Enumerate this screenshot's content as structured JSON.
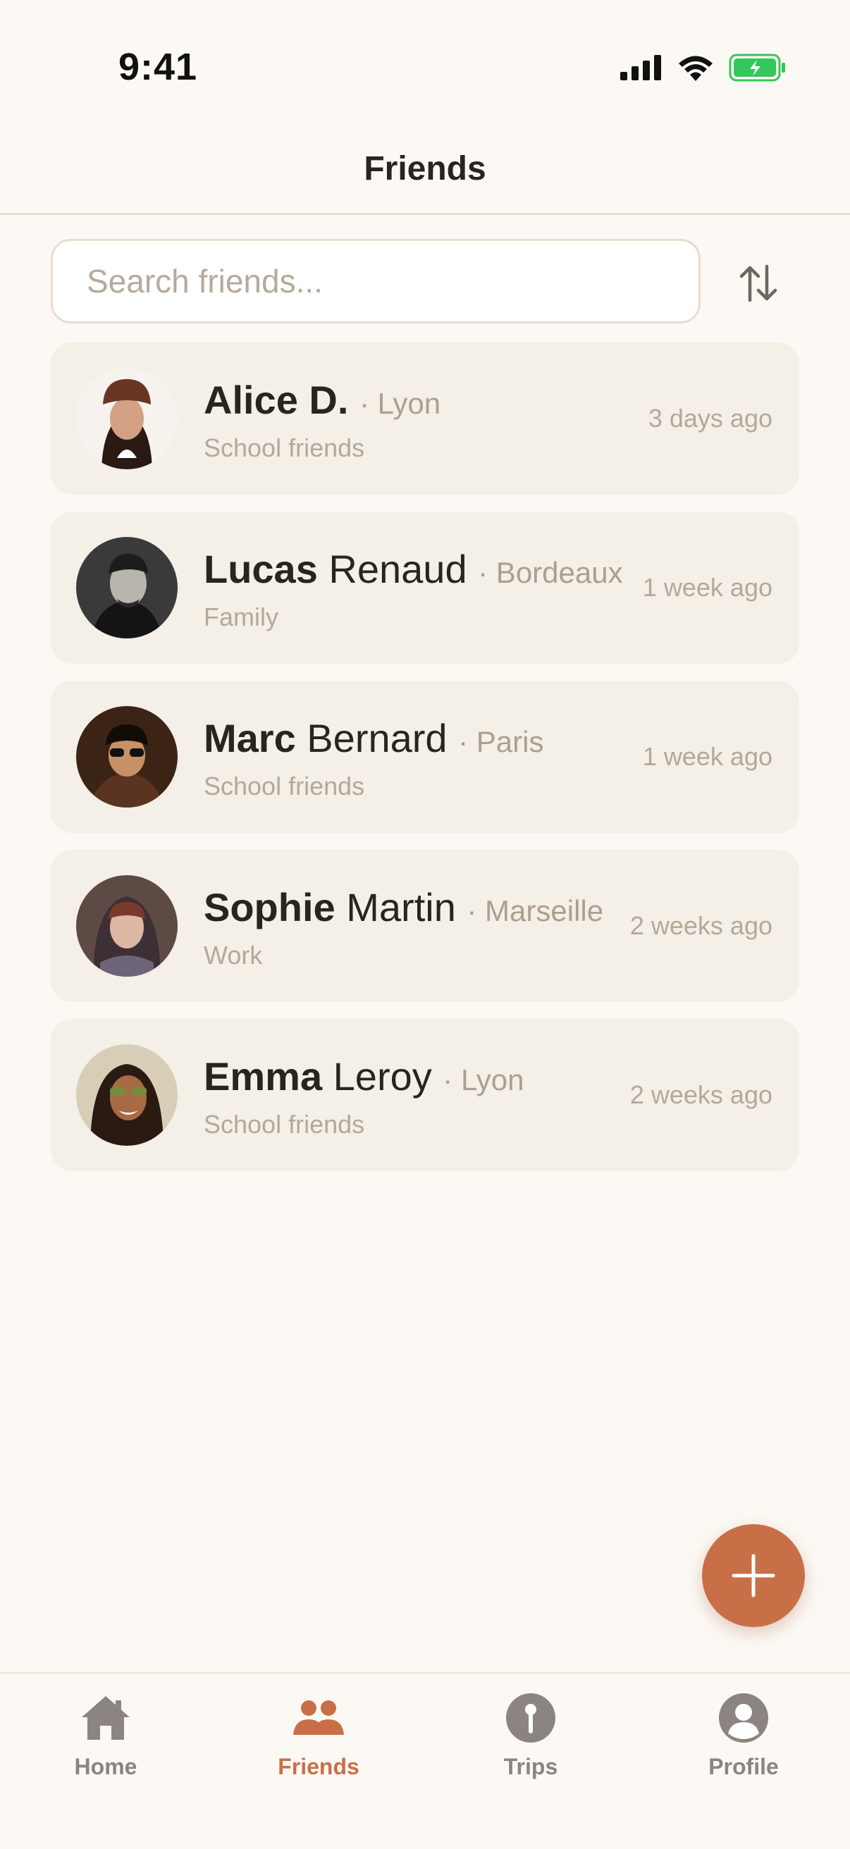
{
  "status_bar": {
    "time": "9:41"
  },
  "header": {
    "title": "Friends"
  },
  "search": {
    "placeholder": "Search friends..."
  },
  "friends": [
    {
      "first": "Alice D.",
      "last": "",
      "city": "· Lyon",
      "group": "School friends",
      "ago": "3 days ago"
    },
    {
      "first": "Lucas",
      "last": " Renaud",
      "city": "· Bordeaux",
      "group": "Family",
      "ago": "1 week ago"
    },
    {
      "first": "Marc",
      "last": " Bernard",
      "city": "· Paris",
      "group": "School friends",
      "ago": "1 week ago"
    },
    {
      "first": "Sophie",
      "last": " Martin",
      "city": "· Marseille",
      "group": "Work",
      "ago": "2 weeks ago"
    },
    {
      "first": "Emma",
      "last": " Leroy",
      "city": "· Lyon",
      "group": "School friends",
      "ago": "2 weeks ago"
    }
  ],
  "tabs": [
    {
      "label": "Home",
      "icon": "home-icon"
    },
    {
      "label": "Friends",
      "icon": "friends-icon"
    },
    {
      "label": "Trips",
      "icon": "pin-icon"
    },
    {
      "label": "Profile",
      "icon": "profile-icon"
    }
  ],
  "colors": {
    "accent": "#c96f48",
    "background": "#fcf9f4",
    "card": "#f4efe7",
    "battery": "#34c759"
  }
}
